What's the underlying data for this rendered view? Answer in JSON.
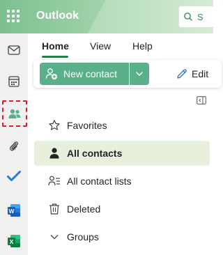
{
  "header": {
    "app_title": "Outlook",
    "search_placeholder": "S"
  },
  "rail": {
    "items": [
      {
        "name": "mail",
        "icon": "mail-icon"
      },
      {
        "name": "calendar",
        "icon": "calendar-icon"
      },
      {
        "name": "people",
        "icon": "people-icon",
        "active": true
      },
      {
        "name": "files",
        "icon": "paperclip-icon"
      },
      {
        "name": "to-do",
        "icon": "todo-check-icon"
      },
      {
        "name": "word",
        "icon": "word-icon"
      },
      {
        "name": "excel",
        "icon": "excel-icon"
      }
    ]
  },
  "tabs": [
    {
      "label": "Home",
      "active": true
    },
    {
      "label": "View",
      "active": false
    },
    {
      "label": "Help",
      "active": false
    }
  ],
  "ribbon": {
    "new_contact_label": "New contact",
    "edit_label": "Edit"
  },
  "nav": {
    "items": [
      {
        "label": "Favorites",
        "icon": "star-icon",
        "selected": false
      },
      {
        "label": "All contacts",
        "icon": "person-icon",
        "selected": true
      },
      {
        "label": "All contact lists",
        "icon": "contact-list-icon",
        "selected": false
      },
      {
        "label": "Deleted",
        "icon": "trash-icon",
        "selected": false
      },
      {
        "label": "Groups",
        "icon": "chevron-down-icon",
        "selected": false
      }
    ]
  },
  "colors": {
    "accent": "#5ab08a",
    "selected_bg": "#e6f0dc",
    "highlight_border": "#e0192b"
  }
}
